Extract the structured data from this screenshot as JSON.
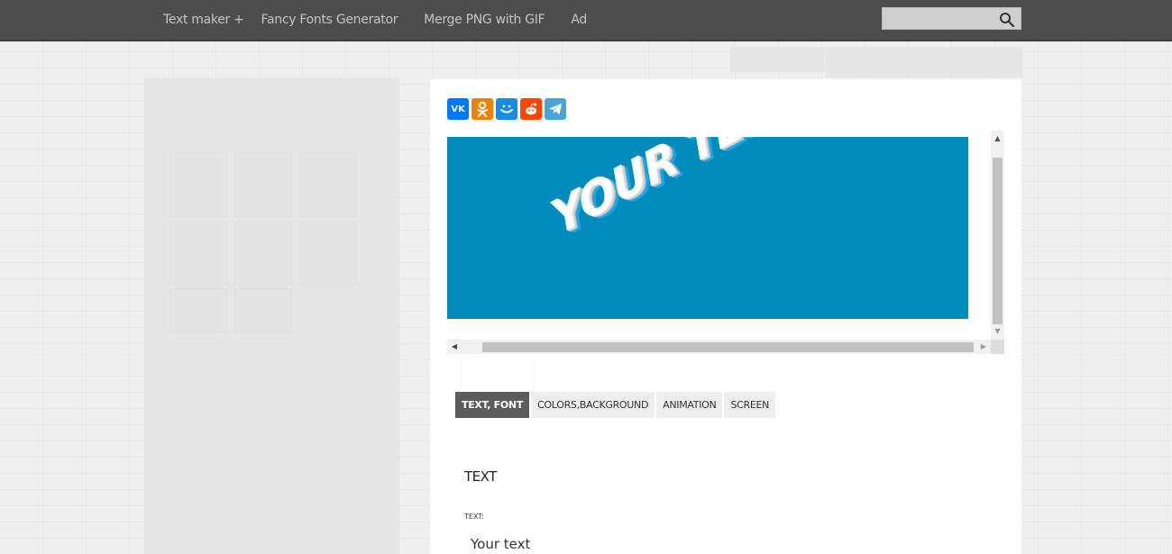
{
  "nav": {
    "items": [
      {
        "label": "Text maker +"
      },
      {
        "label": "Fancy Fonts Generator"
      },
      {
        "label": "Merge PNG with GIF"
      },
      {
        "label": "Ad"
      }
    ]
  },
  "search": {
    "placeholder": "",
    "value": "",
    "icon": "search-icon"
  },
  "share": {
    "buttons": [
      {
        "name": "vk",
        "glyph": "VK",
        "color": "#0077ff"
      },
      {
        "name": "odnoklassniki",
        "glyph": "ok",
        "color": "#ee8208"
      },
      {
        "name": "moimir",
        "glyph": "◡",
        "color": "#168de2"
      },
      {
        "name": "reddit",
        "glyph": "●",
        "color": "#ff4500"
      },
      {
        "name": "telegram",
        "glyph": "➤",
        "color": "#48a6d6"
      }
    ]
  },
  "preview": {
    "text": "YOUR TEXT",
    "background_color": "#008bbd",
    "text_color": "#ffffff",
    "outline_color": "#1aa8e8"
  },
  "tabs": [
    {
      "label": "TEXT, FONT",
      "active": true
    },
    {
      "label": "COLORS,BACKGROUND",
      "active": false
    },
    {
      "label": "ANIMATION",
      "active": false
    },
    {
      "label": "SCREEN",
      "active": false
    }
  ],
  "text_section": {
    "title": "TEXT",
    "field_label": "TEXT:",
    "value": "Your text"
  }
}
